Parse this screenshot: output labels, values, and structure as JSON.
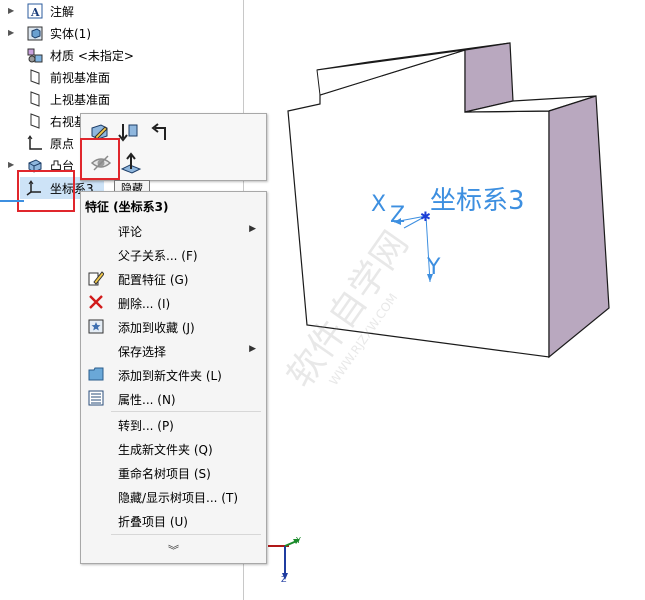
{
  "tree": {
    "items": [
      {
        "label": "注解"
      },
      {
        "label": "实体(1)"
      },
      {
        "label": "材质 <未指定>"
      },
      {
        "label": "前视基准面"
      },
      {
        "label": "上视基准面"
      },
      {
        "label": "右视基"
      },
      {
        "label": "原点"
      },
      {
        "label": "凸台"
      },
      {
        "label": "坐标系3"
      }
    ]
  },
  "tooltip": {
    "text": "隐藏"
  },
  "menu": {
    "header": "特征 (坐标系3)",
    "items": [
      {
        "label": "评论"
      },
      {
        "label": "父子关系... (F)"
      },
      {
        "label": "配置特征 (G)"
      },
      {
        "label": "删除... (I)"
      },
      {
        "label": "添加到收藏 (J)"
      },
      {
        "label": "保存选择"
      },
      {
        "label": "添加到新文件夹 (L)"
      },
      {
        "label": "属性... (N)"
      },
      {
        "label": "转到... (P)"
      },
      {
        "label": "生成新文件夹 (Q)"
      },
      {
        "label": "重命名树项目 (S)"
      },
      {
        "label": "隐藏/显示树项目... (T)"
      },
      {
        "label": "折叠项目 (U)"
      }
    ],
    "more_icon": "double-chevron-down-icon"
  },
  "viewport": {
    "coord_label": "坐标系3",
    "axis_x": "X",
    "axis_y": "Y",
    "axis_z": "Z",
    "triad_y": "Y",
    "triad_z": "Z",
    "watermark": "软件自学网",
    "watermark_url": "WWW.RJZXW.COM"
  },
  "colors": {
    "highlight_red": "#e0262c",
    "accent_blue": "#3d8fe0",
    "selection_bg": "#cde3f7",
    "part_side": "#b9a8bf"
  }
}
